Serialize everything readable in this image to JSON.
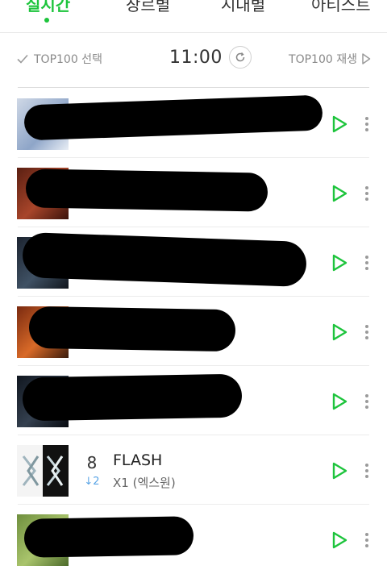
{
  "tabs": [
    {
      "label": "실시간",
      "active": true
    },
    {
      "label": "장르별",
      "active": false
    },
    {
      "label": "시대별",
      "active": false
    },
    {
      "label": "아티스트",
      "active": false
    }
  ],
  "toolbar": {
    "select_label": "TOP100 선택",
    "time": "11:00",
    "play_label": "TOP100 재생"
  },
  "colors": {
    "accent": "#1dc43c",
    "rank_down": "#5aa5e6"
  },
  "songs": [
    {
      "rank": "",
      "change": "",
      "title": "",
      "artist": "",
      "redacted": true
    },
    {
      "rank": "",
      "change": "",
      "title": "",
      "artist": "",
      "redacted": true
    },
    {
      "rank": "",
      "change": "",
      "title": "",
      "artist": "",
      "redacted": true
    },
    {
      "rank": "",
      "change": "",
      "title": "",
      "artist": "",
      "redacted": true
    },
    {
      "rank": "",
      "change": "",
      "title": "",
      "artist": "",
      "redacted": true
    },
    {
      "rank": "8",
      "change": "↓2",
      "title": "FLASH",
      "artist": "X1 (엑스원)",
      "redacted": false
    },
    {
      "rank": "",
      "change": "",
      "title": "",
      "artist": "",
      "redacted": true
    }
  ]
}
